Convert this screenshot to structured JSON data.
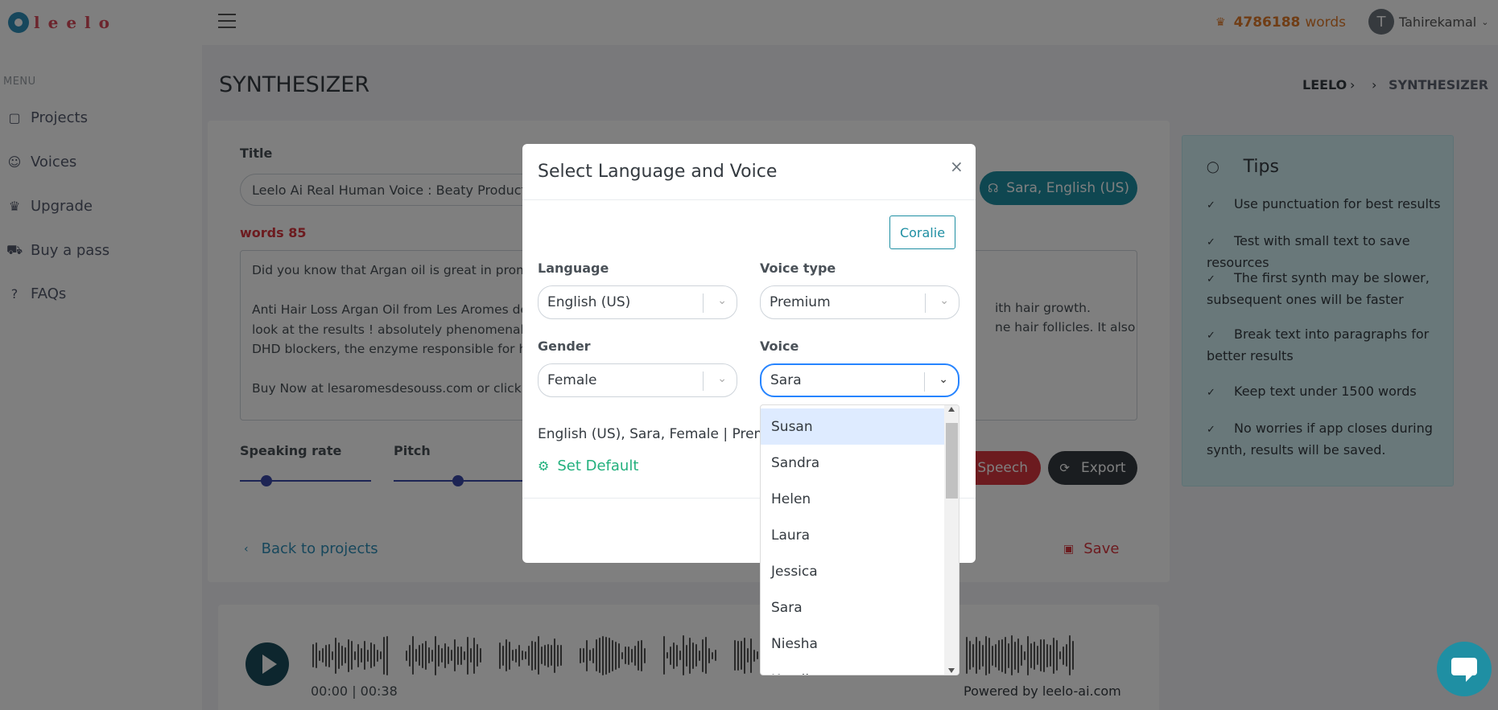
{
  "app": {
    "logo_text": "leelo",
    "words_count": "4786188",
    "words_unit": "words",
    "user_initial": "T",
    "user_name": "Tahirekamal"
  },
  "sidebar": {
    "menu_title": "MENU",
    "items": [
      {
        "label": "Projects",
        "icon": "projects-icon"
      },
      {
        "label": "Voices",
        "icon": "voices-icon"
      },
      {
        "label": "Upgrade",
        "icon": "crown-icon"
      },
      {
        "label": "Buy a pass",
        "icon": "cart-icon"
      },
      {
        "label": "FAQs",
        "icon": "question-icon"
      }
    ]
  },
  "page": {
    "title": "SYNTHESIZER",
    "breadcrumb": [
      "LEELO",
      "SYNTHESIZER"
    ]
  },
  "editor": {
    "title_label": "Title",
    "title_value": "Leelo Ai Real Human Voice : Beaty Product for",
    "words_label": "words 85",
    "text_lines": [
      "Did you know that Argan oil is great in promot",
      "",
      "Anti Hair Loss Argan Oil from Les Aromes de S",
      "look at the results ! absolutely phenomenal, yo",
      "DHD blockers, the enzyme responsible for hair",
      "",
      "Buy Now at lesaromesdesouss.com or click the"
    ],
    "text_right_lines": [
      "ith hair growth.",
      "ne hair follicles. It also has"
    ],
    "voice_button": "Sara, English (US)",
    "speaking_rate_label": "Speaking rate",
    "pitch_label": "Pitch",
    "speaking_rate_value": 0.2,
    "pitch_value": 0.5,
    "speech_button": "e Speech",
    "export_button": "Export",
    "back_link": "Back to projects",
    "save_link": "Save"
  },
  "tips": {
    "title": "Tips",
    "items": [
      "Use punctuation for best results",
      "Test with small text to save resources",
      "The first synth may be slower, subsequent ones will be faster",
      "Break text into paragraphs for better results",
      "Keep text under 1500 words",
      "No worries if app closes during synth, results will be saved."
    ]
  },
  "player": {
    "time": "00:00 | 00:38",
    "powered_by": "Powered by leelo-ai.com"
  },
  "modal": {
    "title": "Select Language and Voice",
    "close_icon": "close-icon",
    "coralie_button": "Coralie",
    "language_label": "Language",
    "language_value": "English (US)",
    "voice_type_label": "Voice type",
    "voice_type_value": "Premium",
    "gender_label": "Gender",
    "gender_value": "Female",
    "voice_label": "Voice",
    "voice_value": "Sara",
    "summary": "English (US), Sara, Female | Premi",
    "set_default": "Set Default",
    "voice_options": [
      "Susan",
      "Sandra",
      "Helen",
      "Laura",
      "Jessica",
      "Sara",
      "Niesha",
      "Kendi"
    ],
    "highlighted_option": "Susan"
  },
  "colors": {
    "accent": "#1f8fa3",
    "danger": "#d9363e",
    "success": "#22b07d",
    "words_badge": "#e07b2a",
    "slider": "#3a49a8"
  }
}
